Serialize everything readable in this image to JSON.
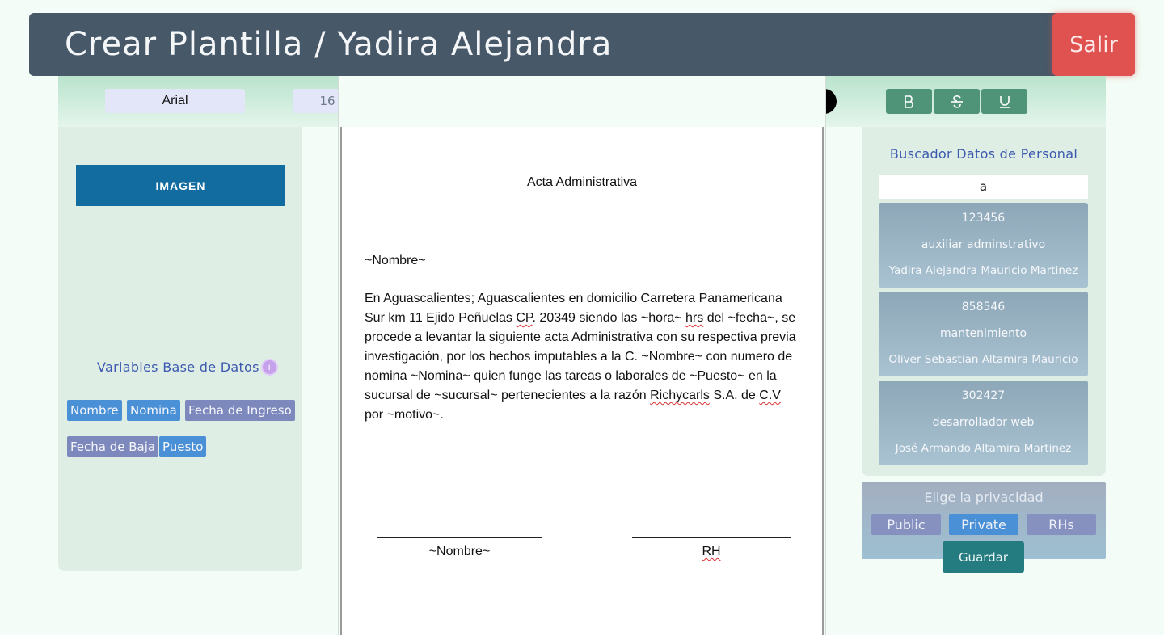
{
  "header": {
    "title": "Crear Plantilla / Yadira Alejandra",
    "exit_label": "Salir"
  },
  "toolbar": {
    "font_family": "Arial",
    "font_size": "16",
    "alignment_selected": "left",
    "text_color_toggle_icon": "text-color-icon",
    "background_toggle_icon": "checkbox-icon",
    "format_buttons": [
      "B",
      "S",
      "U"
    ]
  },
  "left_panel": {
    "image_button": "IMAGEN",
    "variables_title": "Variables Base de Datos",
    "variables": [
      "Nombre",
      "Nomina",
      "Fecha de Ingreso",
      "Fecha de Baja",
      "Puesto"
    ]
  },
  "document": {
    "title": "Acta Administrativa",
    "name_line": "~Nombre~",
    "body_parts": {
      "p1": "En Aguascalientes; Aguascalientes en domicilio Carretera Panamericana Sur km 11 Ejido Peñuelas ",
      "cp": "CP",
      "p2": ". 20349 siendo las ~hora~ ",
      "hrs": "hrs",
      "p3": " del ~fecha~, se procede a levantar la siguiente acta Administrativa con su respectiva previa investigación, por los hechos imputables a la C. ~Nombre~ con numero de nomina ~Nomina~ quien funge las tareas o laborales de ~Puesto~ en la sucursal de ~sucursal~ pertenecientes a la razón ",
      "richycarls": "Richycarls",
      "p4": " S.A. de ",
      "cv": "C.V",
      "p5": " por ~motivo~."
    },
    "signature_left": "~Nombre~",
    "signature_right": "RH"
  },
  "search": {
    "title": "Buscador Datos de Personal",
    "query": "a",
    "results": [
      {
        "id": "123456",
        "role": "auxiliar adminstrativo",
        "name": "Yadira Alejandra Mauricio Martinez"
      },
      {
        "id": "858546",
        "role": "mantenimiento",
        "name": "Oliver Sebastian Altamira Mauricio"
      },
      {
        "id": "302427",
        "role": "desarrollador web",
        "name": "José Armando Altamira Martinez"
      }
    ]
  },
  "privacy": {
    "title": "Elige la privacidad",
    "options": [
      "Public",
      "Private",
      "RHs"
    ],
    "selected": "Private",
    "save_label": "Guardar"
  },
  "colors": {
    "header": "#475869",
    "exit": "#e0524f",
    "toolbar_green": "#4f9478",
    "active_blue": "#4a90d6",
    "image_button": "#136c9f",
    "save_button": "#247c80"
  }
}
